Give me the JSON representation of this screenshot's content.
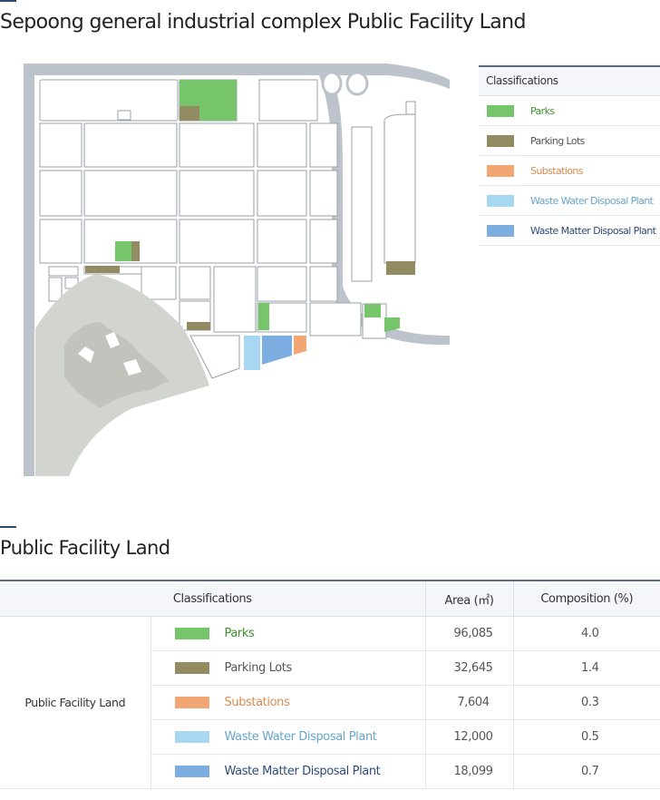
{
  "page": {
    "map_title": "Sepoong general industrial complex Public Facility Land",
    "table_title": "Public Facility Land"
  },
  "colors": {
    "parks": "#77c56a",
    "parking": "#938b62",
    "substations": "#f2a673",
    "waste_water": "#a8d7f2",
    "waste_matter": "#7cade0",
    "road": "#bcc3ca",
    "terrain": "#d2d4cf",
    "accent": "#2d4a6b"
  },
  "legend": {
    "header": "Classifications",
    "items": [
      {
        "label": "Parks",
        "color": "#77c56a",
        "text_color": "#3f8f2e"
      },
      {
        "label": "Parking Lots",
        "color": "#938b62",
        "text_color": "#555555"
      },
      {
        "label": "Substations",
        "color": "#f2a673",
        "text_color": "#d88a50"
      },
      {
        "label": "Waste Water Disposal Plant",
        "color": "#a8d7f2",
        "text_color": "#66a5cf"
      },
      {
        "label": "Waste Matter Disposal Plant",
        "color": "#7cade0",
        "text_color": "#2f4a7a"
      }
    ]
  },
  "table": {
    "headers": {
      "classification": "Classifications",
      "area": "Area (㎡)",
      "composition": "Composition (%)"
    },
    "group_label": "Public Facility Land",
    "rows": [
      {
        "label": "Parks",
        "area": "96,085",
        "composition": "4.0"
      },
      {
        "label": "Parking Lots",
        "area": "32,645",
        "composition": "1.4"
      },
      {
        "label": "Substations",
        "area": "7,604",
        "composition": "0.3"
      },
      {
        "label": "Waste Water Disposal Plant",
        "area": "12,000",
        "composition": "0.5"
      },
      {
        "label": "Waste Matter Disposal Plant",
        "area": "18,099",
        "composition": "0.7"
      }
    ]
  }
}
